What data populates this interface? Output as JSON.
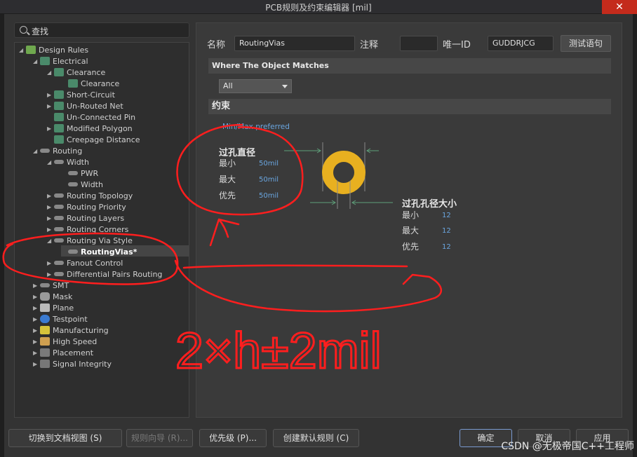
{
  "window": {
    "title": "PCB规则及约束编辑器 [mil]",
    "close_glyph": "✕"
  },
  "search": {
    "label": "查找"
  },
  "tree": [
    {
      "label": "Design Rules",
      "arrow": "◢",
      "icon": "cat"
    },
    {
      "label": "Electrical",
      "arrow": "◢",
      "icon": "rule"
    },
    {
      "label": "Clearance",
      "arrow": "◢",
      "icon": "rule"
    },
    {
      "label": "Clearance",
      "arrow": "",
      "icon": "rule"
    },
    {
      "label": "Short-Circuit",
      "arrow": "▶",
      "icon": "rule"
    },
    {
      "label": "Un-Routed Net",
      "arrow": "▶",
      "icon": "rule"
    },
    {
      "label": "Un-Connected Pin",
      "arrow": "",
      "icon": "rule"
    },
    {
      "label": "Modified Polygon",
      "arrow": "▶",
      "icon": "rule"
    },
    {
      "label": "Creepage Distance",
      "arrow": "",
      "icon": "rule"
    },
    {
      "label": "Routing",
      "arrow": "◢",
      "icon": "route"
    },
    {
      "label": "Width",
      "arrow": "◢",
      "icon": "route"
    },
    {
      "label": "PWR",
      "arrow": "",
      "icon": "route"
    },
    {
      "label": "Width",
      "arrow": "",
      "icon": "route"
    },
    {
      "label": "Routing Topology",
      "arrow": "▶",
      "icon": "route"
    },
    {
      "label": "Routing Priority",
      "arrow": "▶",
      "icon": "route"
    },
    {
      "label": "Routing Layers",
      "arrow": "▶",
      "icon": "route"
    },
    {
      "label": "Routing Corners",
      "arrow": "▶",
      "icon": "route"
    },
    {
      "label": "Routing Via Style",
      "arrow": "◢",
      "icon": "route"
    },
    {
      "label": "RoutingVias*",
      "arrow": "",
      "icon": "route"
    },
    {
      "label": "Fanout Control",
      "arrow": "▶",
      "icon": "route"
    },
    {
      "label": "Differential Pairs Routing",
      "arrow": "▶",
      "icon": "route"
    },
    {
      "label": "SMT",
      "arrow": "▶",
      "icon": "route"
    },
    {
      "label": "Mask",
      "arrow": "▶",
      "icon": "mask"
    },
    {
      "label": "Plane",
      "arrow": "▶",
      "icon": "plane"
    },
    {
      "label": "Testpoint",
      "arrow": "▶",
      "icon": "tp"
    },
    {
      "label": "Manufacturing",
      "arrow": "▶",
      "icon": "mfg"
    },
    {
      "label": "High Speed",
      "arrow": "▶",
      "icon": "hs"
    },
    {
      "label": "Placement",
      "arrow": "▶",
      "icon": "pl"
    },
    {
      "label": "Signal Integrity",
      "arrow": "▶",
      "icon": "si"
    }
  ],
  "rule": {
    "name_label": "名称",
    "name_value": "RoutingVias",
    "comment_label": "注释",
    "comment_value": "",
    "id_label": "唯一ID",
    "id_value": "GUDDRJCG",
    "test_button": "测试语句"
  },
  "where": {
    "header": "Where The Object Matches",
    "select_value": "All"
  },
  "constraints": {
    "header": "约束",
    "mode": "Min/Max preferred",
    "via_diameter": {
      "title": "过孔直径",
      "min_label": "最小",
      "min": "50mil",
      "max_label": "最大",
      "max": "50mil",
      "pref_label": "优先",
      "pref": "50mil"
    },
    "hole_size": {
      "title": "过孔孔径大小",
      "min_label": "最小",
      "min": "12",
      "max_label": "最大",
      "max": "12",
      "pref_label": "优先",
      "pref": "12"
    }
  },
  "annotation": {
    "formula": "2×h±2mil"
  },
  "buttons": {
    "doc_view": "切换到文档视图 (S)",
    "rule_wizard": "规则向导 (R)...",
    "priority": "优先级 (P)...",
    "create_default": "创建默认规则 (C)",
    "ok": "确定",
    "cancel": "取消",
    "apply": "应用"
  },
  "watermark": "CSDN @无极帝国C++工程师",
  "colors": {
    "via_ring": "#e8b020",
    "annotation_red": "#ff1e1e",
    "value_blue": "#6aa6e0"
  }
}
